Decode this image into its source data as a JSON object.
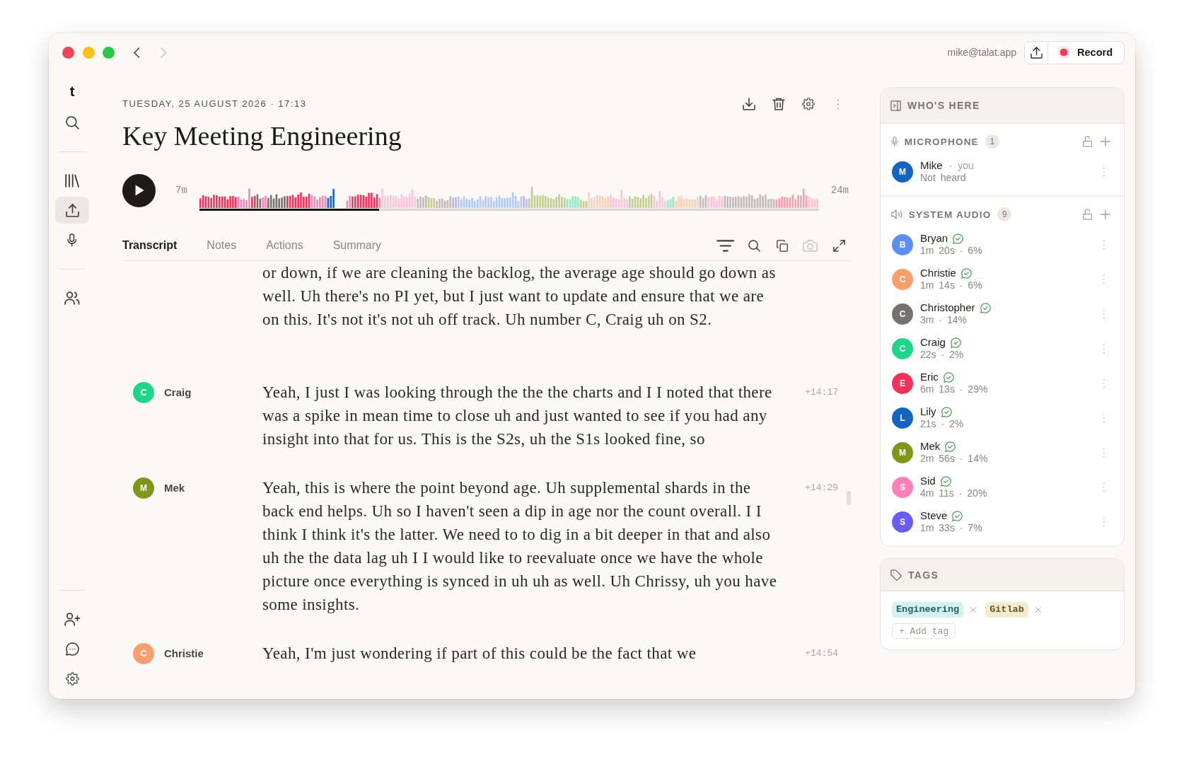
{
  "window": {
    "nav": [
      {
        "kind": "back",
        "disabled": false
      },
      {
        "kind": "forward",
        "disabled": true
      }
    ],
    "account": "mike@talat.app",
    "record_button": {
      "label": "Record"
    }
  },
  "sidebar": {
    "logo": "t",
    "groups": [
      {
        "items": [
          {
            "kind": "search",
            "selected": false
          }
        ]
      },
      {
        "items": [
          {
            "kind": "library",
            "selected": false
          },
          {
            "kind": "upload",
            "selected": true
          },
          {
            "kind": "microphone",
            "selected": false
          }
        ]
      },
      {
        "items": [
          {
            "kind": "people",
            "selected": false
          }
        ]
      }
    ],
    "footer_items": [
      {
        "kind": "invite",
        "selected": false
      },
      {
        "kind": "chat",
        "selected": false
      },
      {
        "kind": "settings",
        "selected": false
      }
    ]
  },
  "meeting": {
    "date": "TUESDAY, 25 AUGUST 2026 · 17:13",
    "title": "Key Meeting Engineering"
  },
  "player": {
    "playing": false,
    "elapsed": "7m",
    "total": "24m",
    "progress": {
      "level": 0.29
    }
  },
  "tabs": [
    {
      "label": "Transcript",
      "selected": true
    },
    {
      "label": "Notes",
      "selected": false
    },
    {
      "label": "Actions",
      "selected": false
    },
    {
      "label": "Summary",
      "selected": false
    }
  ],
  "toolbar": [
    {
      "kind": "filter",
      "disabled": false
    },
    {
      "kind": "search",
      "disabled": false
    },
    {
      "kind": "copy",
      "disabled": false
    },
    {
      "kind": "camera",
      "disabled": true
    },
    {
      "kind": "expand",
      "disabled": false
    }
  ],
  "transcript": [
    {
      "kind": "continuation",
      "text": "or down, if we are cleaning the backlog, the average age should go down as well. Uh there's no PI yet, but I just want to update and ensure that we are on this. It's not it's not uh off track. Uh number C, Craig uh on S2."
    },
    {
      "kind": "utterance",
      "speaker": "Craig",
      "initial": "C",
      "color": "#1ed58a",
      "time": "+14:17",
      "text": "Yeah, I just I was looking through the the the charts and I I noted that there was a spike in mean time to close uh and just wanted to see if you had any insight into that for us. This is the S2s, uh the S1s looked fine, so"
    },
    {
      "kind": "utterance",
      "speaker": "Mek",
      "initial": "M",
      "color": "#7e9718",
      "time": "+14:29",
      "text": "Yeah, this is where the point beyond age. Uh supplemental shards in the back end helps. Uh so I haven't seen a dip in age nor the count overall. I I think I think it's the latter. We need to to dig in a bit deeper in that and also uh the the data lag uh I I would like to reevaluate once we have the whole picture once everything is synced in uh uh as well. Uh Chrissy, uh you have some insights."
    },
    {
      "kind": "utterance",
      "speaker": "Christie",
      "initial": "C",
      "color": "#f99e6e",
      "time": "+14:54",
      "text": "Yeah, I'm just wondering if part of this could be the fact that we"
    }
  ],
  "participants_panel": {
    "title": "WHO'S HERE",
    "sections": [
      {
        "kind": "microphone",
        "title": "MICROPHONE",
        "count": "1",
        "locked": false,
        "participants": [
          {
            "name": "Mike",
            "initial": "M",
            "color": "#1565c0",
            "note": "· you",
            "detail": "Not heard",
            "verified": false
          }
        ]
      },
      {
        "kind": "system_audio",
        "title": "SYSTEM AUDIO",
        "count": "9",
        "locked": false,
        "participants": [
          {
            "name": "Bryan",
            "initial": "B",
            "color": "#5b8cf7",
            "detail": "1m 20s · 6%",
            "verified": true
          },
          {
            "name": "Christie",
            "initial": "C",
            "color": "#f99e6e",
            "detail": "1m 14s · 6%",
            "verified": true
          },
          {
            "name": "Christopher",
            "initial": "C",
            "color": "#77726d",
            "detail": "3m · 14%",
            "verified": true
          },
          {
            "name": "Craig",
            "initial": "C",
            "color": "#1ed58a",
            "detail": "22s · 2%",
            "verified": true
          },
          {
            "name": "Eric",
            "initial": "E",
            "color": "#f2325b",
            "detail": "6m 13s · 29%",
            "verified": true
          },
          {
            "name": "Lily",
            "initial": "L",
            "color": "#1565c0",
            "detail": "21s · 2%",
            "verified": true
          },
          {
            "name": "Mek",
            "initial": "M",
            "color": "#7e9718",
            "detail": "2m 56s · 14%",
            "verified": true
          },
          {
            "name": "Sid",
            "initial": "S",
            "color": "#ff80b9",
            "detail": "4m 11s · 20%",
            "verified": true
          },
          {
            "name": "Steve",
            "initial": "S",
            "color": "#675cf5",
            "detail": "1m 33s · 7%",
            "verified": true
          }
        ]
      }
    ]
  },
  "tags": {
    "title": "TAGS",
    "items": [
      {
        "label": "Engineering",
        "color": "#d3f0f2"
      },
      {
        "label": "Gitlab",
        "color": "#f4ead0"
      }
    ],
    "add_label": "+ Add tag"
  }
}
